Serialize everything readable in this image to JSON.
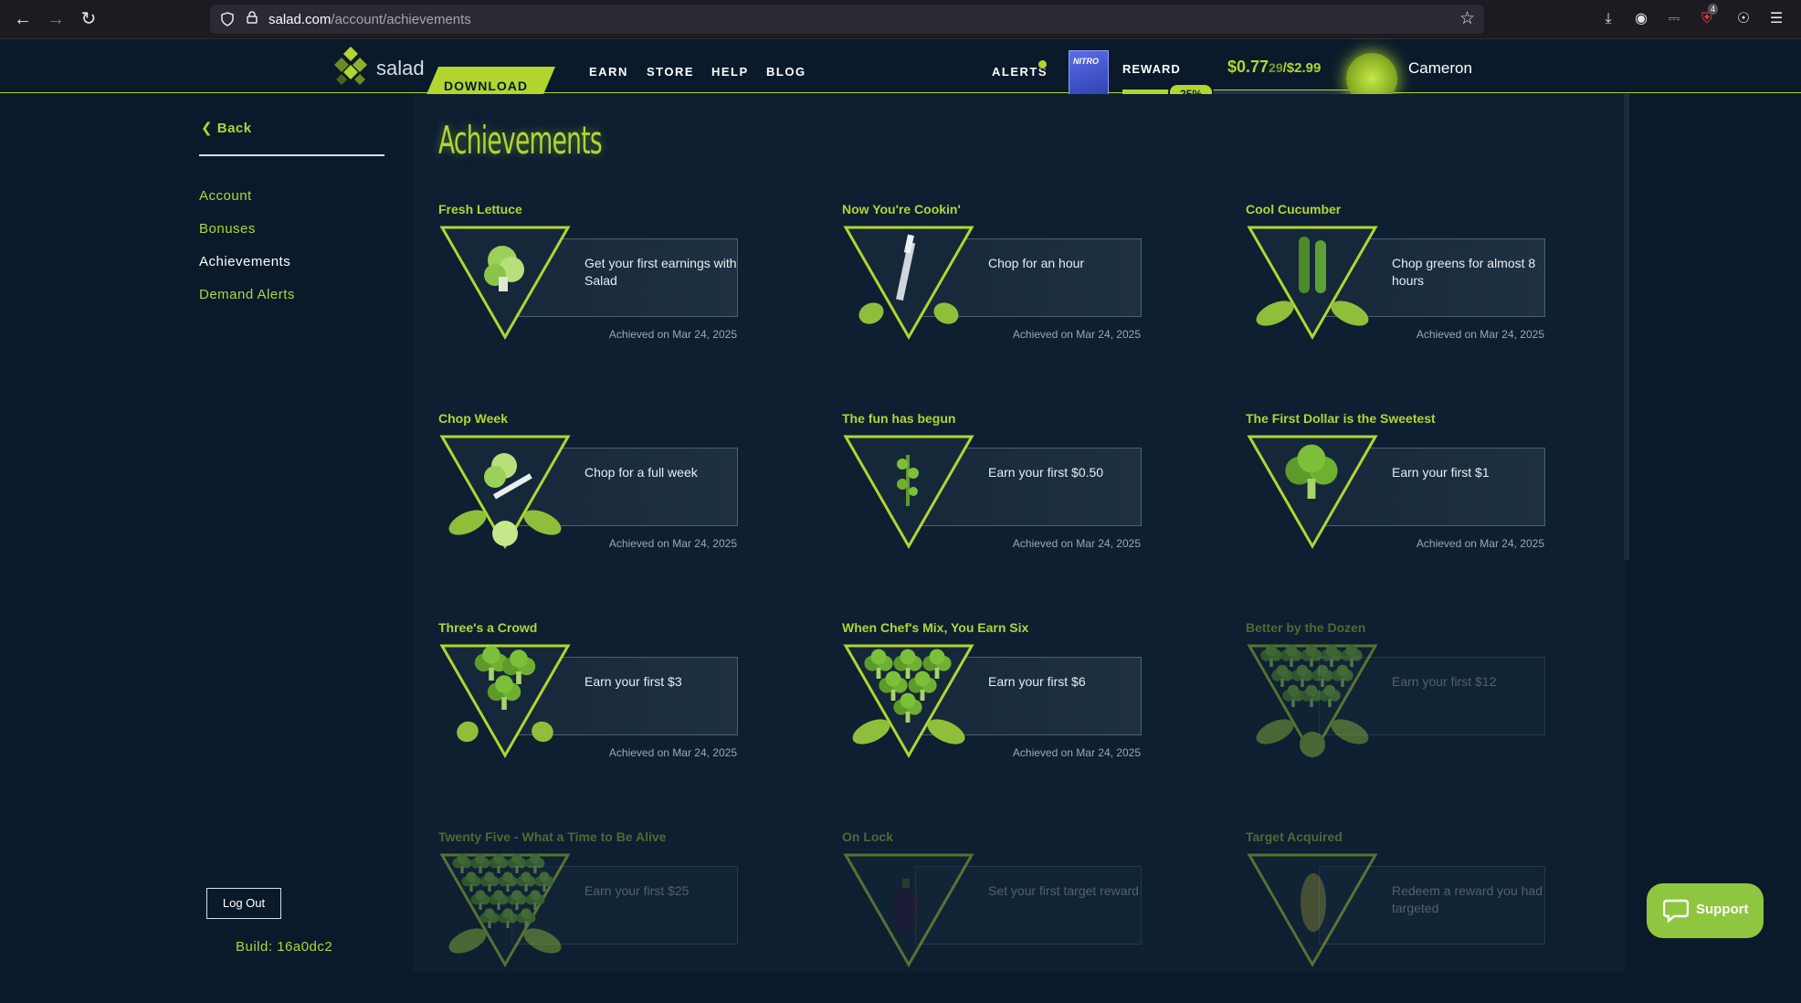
{
  "browser": {
    "url_domain": "salad.com",
    "url_path": "/account/achievements",
    "badge_count": "4"
  },
  "header": {
    "logo_text": "salad",
    "download_label": "DOWNLOAD",
    "nav": [
      "EARN",
      "STORE",
      "HELP",
      "BLOG"
    ],
    "alerts_label": "ALERTS",
    "reward_label": "REWARD",
    "reward_product_text": "NITRO",
    "reward_progress_percent": 25,
    "reward_progress_label": "25%",
    "balance_main": "$0.77",
    "balance_fraction": "29",
    "balance_sep": "/",
    "balance_target": "$2.99",
    "username": "Cameron"
  },
  "sidebar": {
    "back_label": "Back",
    "links": [
      "Account",
      "Bonuses",
      "Achievements",
      "Demand Alerts"
    ],
    "active_index": 2,
    "logout_label": "Log Out",
    "build_label": "Build: 16a0dc2"
  },
  "main": {
    "title": "Achievements",
    "achievements": [
      {
        "name": "Fresh Lettuce",
        "description": "Get your first earnings with Salad",
        "date": "Achieved on Mar 24, 2025",
        "locked": false,
        "icon": "lettuce-icon"
      },
      {
        "name": "Now You're Cookin'",
        "description": "Chop for an hour",
        "date": "Achieved on Mar 24, 2025",
        "locked": false,
        "icon": "knife-icon"
      },
      {
        "name": "Cool Cucumber",
        "description": "Chop greens for almost 8 hours",
        "date": "Achieved on Mar 24, 2025",
        "locked": false,
        "icon": "cucumber-icon"
      },
      {
        "name": "Chop Week",
        "description": "Chop for a full week",
        "date": "Achieved on Mar 24, 2025",
        "locked": false,
        "icon": "lettuce-knife-icon"
      },
      {
        "name": "The fun has begun",
        "description": "Earn your first $0.50",
        "date": "Achieved on Mar 24, 2025",
        "locked": false,
        "icon": "herb-icon"
      },
      {
        "name": "The First Dollar is the Sweetest",
        "description": "Earn your first $1",
        "date": "Achieved on Mar 24, 2025",
        "locked": false,
        "icon": "broccoli-icon"
      },
      {
        "name": "Three's a Crowd",
        "description": "Earn your first $3",
        "date": "Achieved on Mar 24, 2025",
        "locked": false,
        "icon": "broccoli-three-icon"
      },
      {
        "name": "When Chef's Mix, You Earn Six",
        "description": "Earn your first $6",
        "date": "Achieved on Mar 24, 2025",
        "locked": false,
        "icon": "broccoli-six-icon"
      },
      {
        "name": "Better by the Dozen",
        "description": "Earn your first $12",
        "date": "",
        "locked": true,
        "icon": "broccoli-dozen-icon"
      },
      {
        "name": "Twenty Five - What a Time to Be Alive",
        "description": "Earn your first $25",
        "date": "",
        "locked": true,
        "icon": "broccoli-many-icon"
      },
      {
        "name": "On Lock",
        "description": "Set your first target reward",
        "date": "",
        "locked": true,
        "icon": "eggplant-icon"
      },
      {
        "name": "Target Acquired",
        "description": "Redeem a reward you had targeted",
        "date": "",
        "locked": true,
        "icon": "pickle-icon"
      }
    ]
  },
  "support_label": "Support",
  "colors": {
    "accent": "#b2d530",
    "background": "#0a1a2b",
    "panel": "#0d1f31"
  }
}
